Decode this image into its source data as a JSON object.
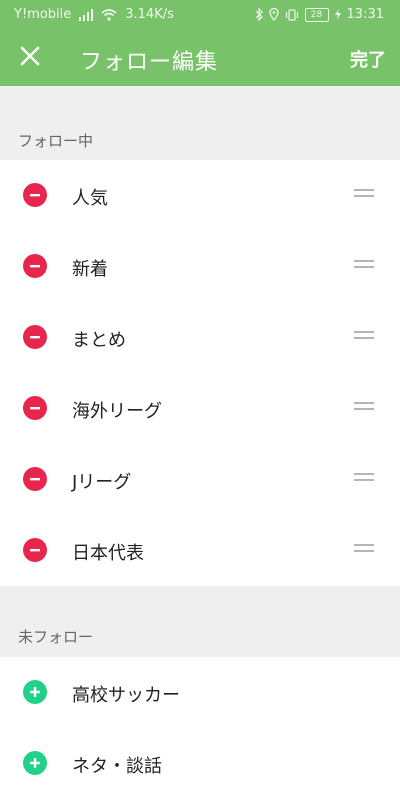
{
  "status_bar": {
    "carrier": "Y!mobile",
    "speed": "3.14K/s",
    "battery": "28",
    "time": "13:31"
  },
  "header": {
    "title": "フォロー編集",
    "done_label": "完了"
  },
  "following": {
    "header": "フォロー中",
    "items": [
      {
        "label": "人気"
      },
      {
        "label": "新着"
      },
      {
        "label": "まとめ"
      },
      {
        "label": "海外リーグ"
      },
      {
        "label": "Jリーグ"
      },
      {
        "label": "日本代表"
      }
    ]
  },
  "not_following": {
    "header": "未フォロー",
    "items": [
      {
        "label": "高校サッカー"
      },
      {
        "label": "ネタ・談話"
      }
    ]
  },
  "colors": {
    "accent": "#78c36a",
    "remove": "#e7254d",
    "add": "#22d08a"
  }
}
